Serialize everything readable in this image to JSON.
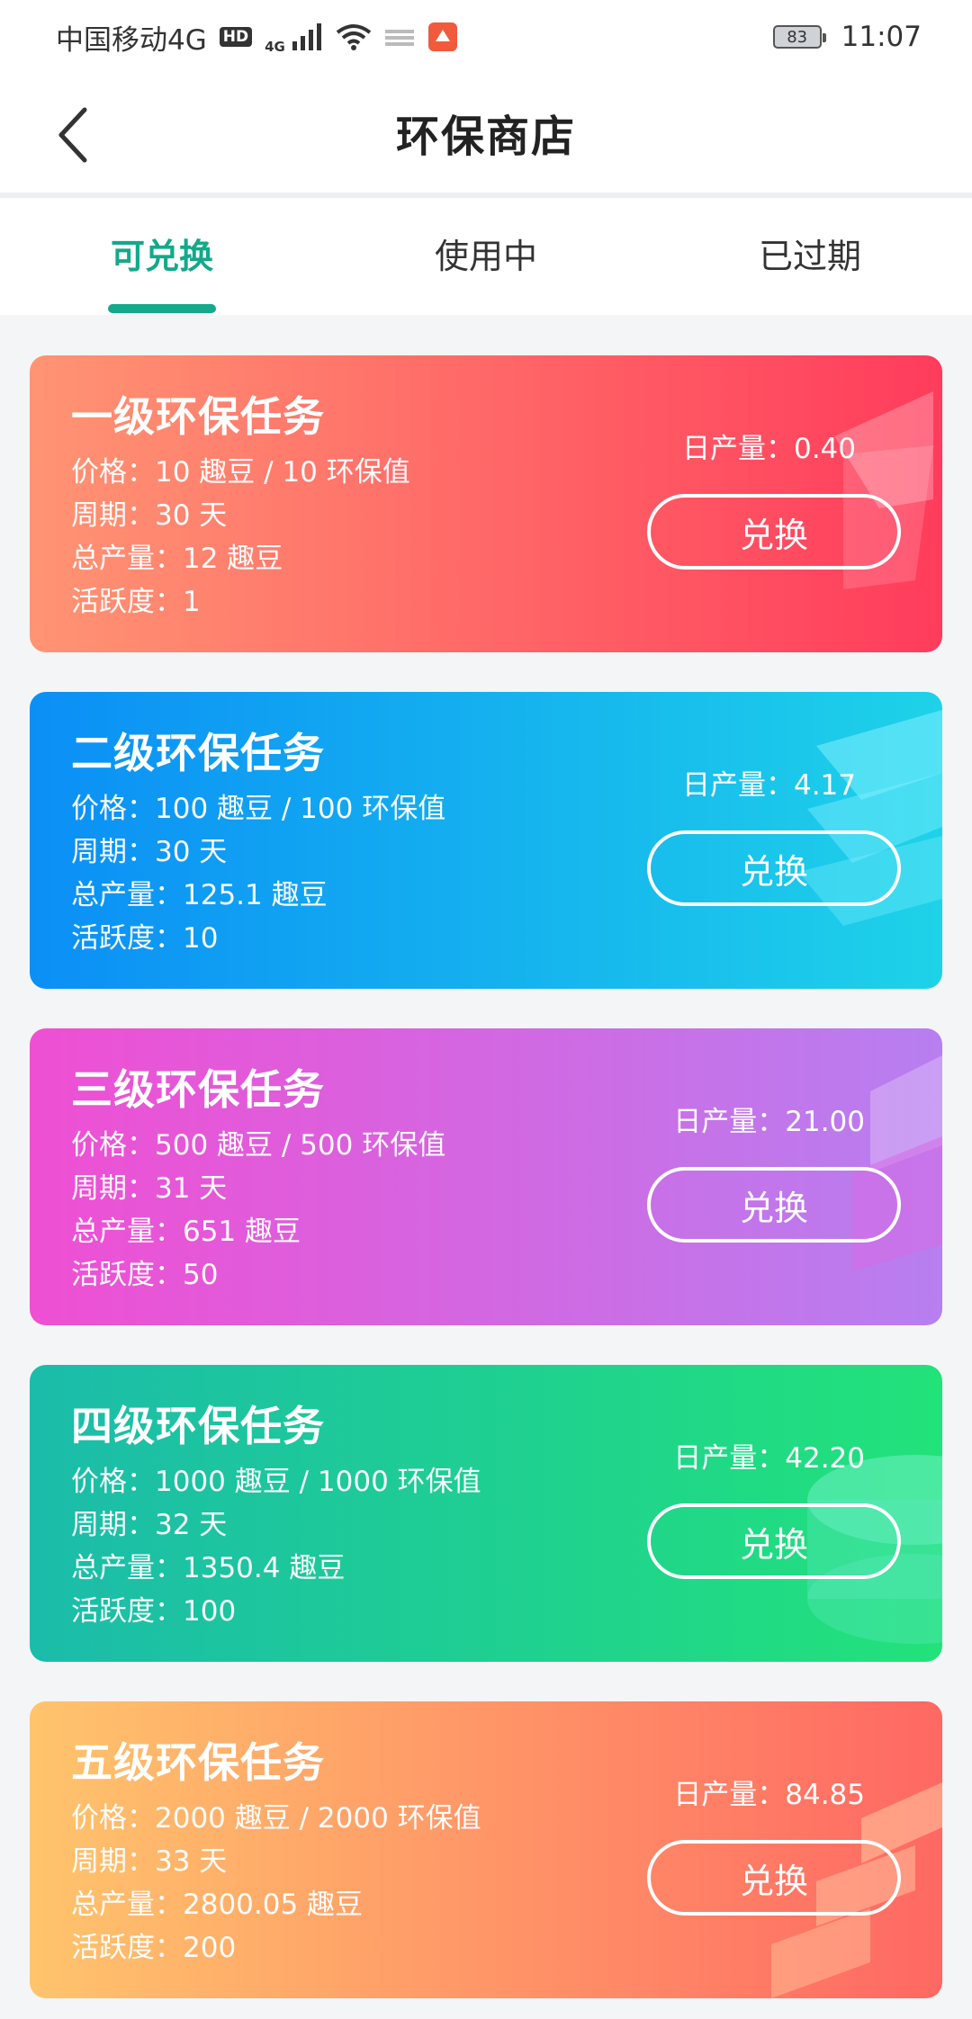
{
  "status_bar": {
    "carrier": "中国移动4G",
    "hd": "HD",
    "net": "4G",
    "battery": "83",
    "time": "11:07"
  },
  "header": {
    "title": "环保商店"
  },
  "tabs": [
    {
      "label": "可兑换",
      "active": true
    },
    {
      "label": "使用中",
      "active": false
    },
    {
      "label": "已过期",
      "active": false
    }
  ],
  "cards": [
    {
      "title": "一级环保任务",
      "price": "价格：10 趣豆 / 10 环保值",
      "period": "周期：30 天",
      "total": "总产量：12 趣豆",
      "activity": "活跃度：1",
      "daily": "日产量：0.40",
      "button": "兑换",
      "colors": [
        "#ff8f6b",
        "#ff3b5c"
      ]
    },
    {
      "title": "二级环保任务",
      "price": "价格：100 趣豆 / 100 环保值",
      "period": "周期：30 天",
      "total": "总产量：125.1 趣豆",
      "activity": "活跃度：10",
      "daily": "日产量：4.17",
      "button": "兑换",
      "colors": [
        "#0a8ff5",
        "#21d7e6"
      ]
    },
    {
      "title": "三级环保任务",
      "price": "价格：500 趣豆 / 500 环保值",
      "period": "周期：31 天",
      "total": "总产量：651 趣豆",
      "activity": "活跃度：50",
      "daily": "日产量：21.00",
      "button": "兑换",
      "colors": [
        "#ee4fd2",
        "#b97ef0"
      ]
    },
    {
      "title": "四级环保任务",
      "price": "价格：1000 趣豆 / 1000 环保值",
      "period": "周期：32 天",
      "total": "总产量：1350.4 趣豆",
      "activity": "活跃度：100",
      "daily": "日产量：42.20",
      "button": "兑换",
      "colors": [
        "#1cbfaa",
        "#21e27a"
      ]
    },
    {
      "title": "五级环保任务",
      "price": "价格：2000 趣豆 / 2000 环保值",
      "period": "周期：33 天",
      "total": "总产量：2800.05 趣豆",
      "activity": "活跃度：200",
      "daily": "日产量：84.85",
      "button": "兑换",
      "colors": [
        "#ffc36b",
        "#ff6464"
      ]
    }
  ],
  "icons": {
    "back": "chevron-left-icon",
    "signal": "signal-icon",
    "wifi": "wifi-icon",
    "battery": "battery-icon"
  },
  "accent_color": "#13a98a"
}
